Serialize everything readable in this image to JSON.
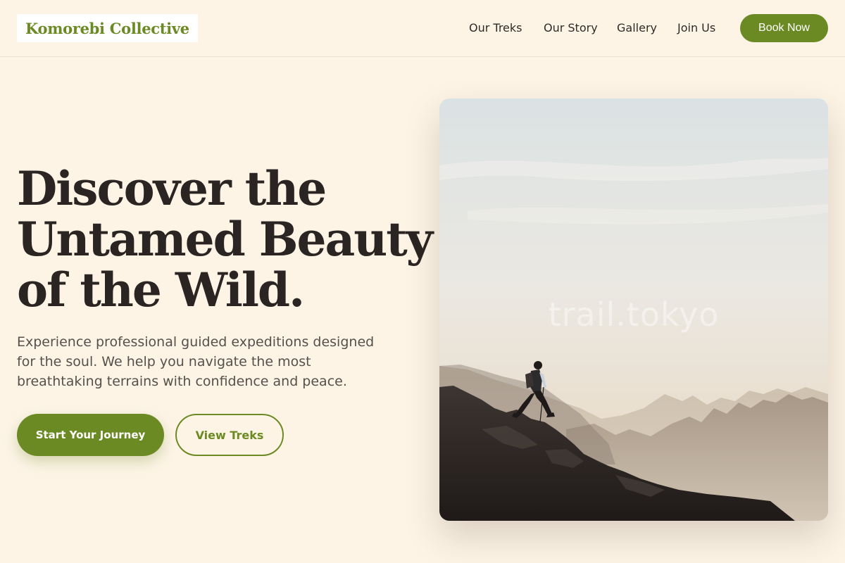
{
  "brand": {
    "name": "Komorebi Collective",
    "color": "#6b8a23"
  },
  "nav": {
    "items": [
      {
        "label": "Our Treks"
      },
      {
        "label": "Our Story"
      },
      {
        "label": "Gallery"
      },
      {
        "label": "Join Us"
      }
    ],
    "cta_label": "Book Now"
  },
  "hero": {
    "title_lines": [
      "Discover the",
      "Untamed Beauty",
      "of the Wild."
    ],
    "subtitle": "Experience professional guided expeditions designed for the soul. We help you navigate the most breathtaking terrains with confidence and peace.",
    "primary_button": "Start Your Journey",
    "secondary_button": "View Treks"
  },
  "image": {
    "watermark": "trail.tokyo"
  },
  "colors": {
    "background": "#fdf4e6",
    "accent": "#6b8a23",
    "heading": "#2a2522",
    "body_text": "#55504b"
  }
}
